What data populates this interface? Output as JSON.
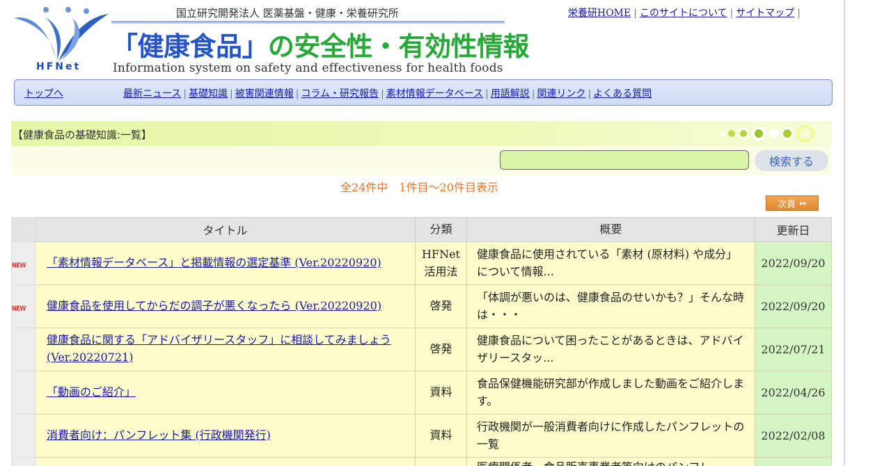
{
  "header": {
    "org_name": "国立研究開発法人 医薬基盤・健康・栄養研究所",
    "logo_text": "HFNet",
    "title_part_blue": "「健康食品」",
    "title_part_green": "の安全性・有効性情報",
    "subtitle": "Information system on safety and effectiveness for health foods",
    "colors": {
      "title_blue": "#2554c7",
      "title_green": "#29a83a"
    }
  },
  "top_links": [
    "栄養研HOME",
    "このサイトについて",
    "サイトマップ"
  ],
  "nav": {
    "home_label": "トップへ",
    "links": [
      "最新ニュース",
      "基礎知識",
      "被害関連情報",
      "コラム・研究報告",
      "素材情報データベース",
      "用語解説",
      "関連リンク",
      "よくある質問"
    ]
  },
  "section": {
    "title": "【健康食品の基礎知識:一覧】"
  },
  "search": {
    "value": "",
    "button_label": "検索する"
  },
  "results_summary": "全24件中　1件目〜20件目表示",
  "next_button": {
    "label": "次頁",
    "arrows": "▸▸"
  },
  "table": {
    "headers": [
      "タイトル",
      "分類",
      "概要",
      "更新日"
    ],
    "new_badge": "NEW",
    "rows": [
      {
        "is_new": true,
        "title": "「素材情報データベース」と掲載情報の選定基準 (Ver.20220920)",
        "category": "HFNet 活用法",
        "summary": "健康食品に使用されている「素材 (原材料) や成分」について情報...",
        "date": "2022/09/20"
      },
      {
        "is_new": true,
        "title": "健康食品を使用してからだの調子が悪くなったら (Ver.20220920)",
        "category": "啓発",
        "summary": "「体調が悪いのは、健康食品のせいかも？」そんな時は・・・",
        "date": "2022/09/20"
      },
      {
        "is_new": false,
        "title": "健康食品に関する「アドバイザリースタッフ」に相談してみましょう (Ver.20220721)",
        "category": "啓発",
        "summary": "健康食品について困ったことがあるときは、アドバイザリースタッ...",
        "date": "2022/07/21"
      },
      {
        "is_new": false,
        "title": "「動画のご紹介」",
        "category": "資料",
        "summary": "食品保健機能研究部が作成しました動画をご紹介します。",
        "date": "2022/04/26"
      },
      {
        "is_new": false,
        "title": "消費者向け：パンフレット集 (行政機関発行)",
        "category": "資料",
        "summary": "行政機関が一般消費者向けに作成したパンフレットの一覧",
        "date": "2022/02/08"
      },
      {
        "is_new": false,
        "title": "",
        "category": "",
        "summary": "医療関係者、食品販売事業者等向けのパンフレ",
        "date": ""
      }
    ]
  }
}
